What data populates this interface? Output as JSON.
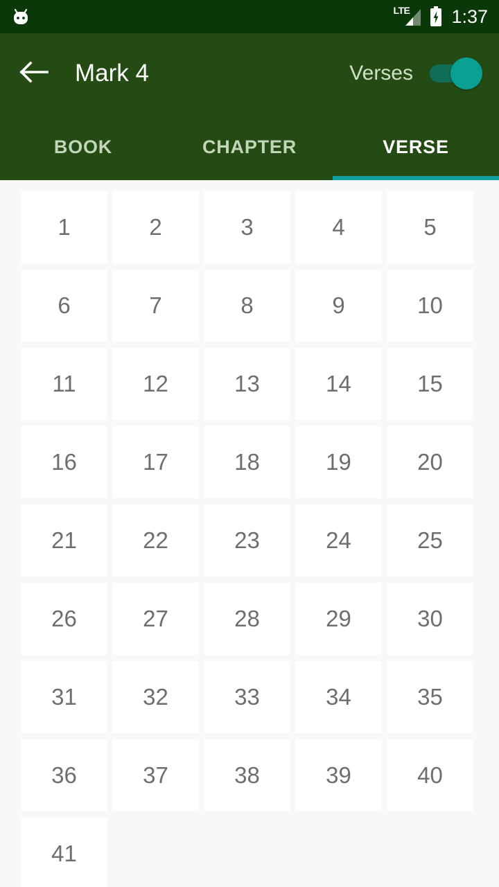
{
  "status_bar": {
    "app_icon": "android-head-icon",
    "network_type": "LTE",
    "signal_icon": "signal-bars-icon",
    "battery_icon": "battery-charging-icon",
    "time": "1:37",
    "background_color": "#0b3808"
  },
  "app_bar": {
    "back_icon": "arrow-back-icon",
    "title": "Mark 4",
    "toggle_label": "Verses",
    "toggle_state": "on",
    "toggle_track_color": "#0f6e55",
    "toggle_thumb_color": "#0aa092",
    "background_color": "#254b15"
  },
  "tabs": {
    "items": [
      {
        "label": "BOOK",
        "active": false
      },
      {
        "label": "CHAPTER",
        "active": false
      },
      {
        "label": "VERSE",
        "active": true
      }
    ],
    "indicator_color": "#10a0a0"
  },
  "grid": {
    "columns": 5,
    "cell_text_color": "#6e6e6e",
    "cell_background": "#ffffff",
    "background_color": "#f8f8f8",
    "items": [
      "1",
      "2",
      "3",
      "4",
      "5",
      "6",
      "7",
      "8",
      "9",
      "10",
      "11",
      "12",
      "13",
      "14",
      "15",
      "16",
      "17",
      "18",
      "19",
      "20",
      "21",
      "22",
      "23",
      "24",
      "25",
      "26",
      "27",
      "28",
      "29",
      "30",
      "31",
      "32",
      "33",
      "34",
      "35",
      "36",
      "37",
      "38",
      "39",
      "40",
      "41"
    ]
  }
}
